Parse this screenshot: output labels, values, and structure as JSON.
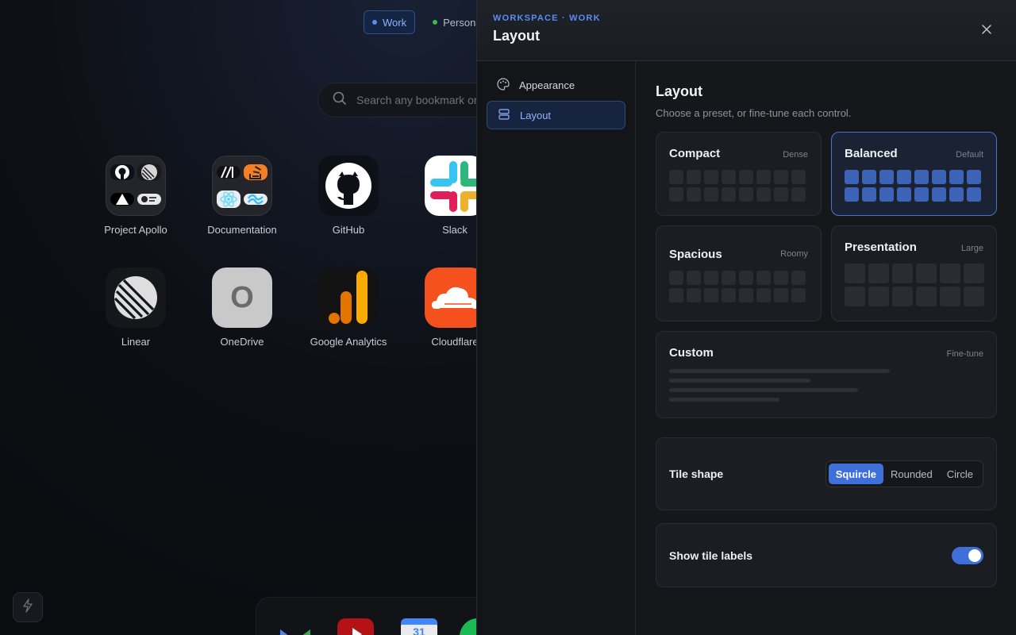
{
  "workspaces": [
    {
      "label": "Work",
      "color": "#5b8def",
      "active": true
    },
    {
      "label": "Personal",
      "color": "#3fb950",
      "active": false
    }
  ],
  "search": {
    "placeholder": "Search any bookmark or"
  },
  "tiles": [
    {
      "label": "Project Apollo",
      "icon": "folder-icon"
    },
    {
      "label": "Documentation",
      "icon": "folder-icon"
    },
    {
      "label": "GitHub",
      "icon": "github-icon"
    },
    {
      "label": "Slack",
      "icon": "slack-icon"
    },
    {
      "label": "Linear",
      "icon": "linear-icon"
    },
    {
      "label": "OneDrive",
      "icon": "onedrive-icon",
      "letter": "O"
    },
    {
      "label": "Google Analytics",
      "icon": "analytics-icon"
    },
    {
      "label": "Cloudflare",
      "icon": "cloudflare-icon"
    }
  ],
  "calendar_day": "31",
  "panel": {
    "eyebrow": "WORKSPACE · WORK",
    "title": "Layout",
    "nav": [
      {
        "label": "Appearance",
        "icon": "palette-icon"
      },
      {
        "label": "Layout",
        "icon": "layout-icon",
        "active": true
      }
    ],
    "section_title": "Layout",
    "section_subtitle": "Choose a preset, or fine-tune each control.",
    "presets": [
      {
        "name": "Compact",
        "tag": "Dense"
      },
      {
        "name": "Balanced",
        "tag": "Default",
        "selected": true
      },
      {
        "name": "Spacious",
        "tag": "Roomy"
      },
      {
        "name": "Presentation",
        "tag": "Large"
      },
      {
        "name": "Custom",
        "tag": "Fine-tune"
      }
    ],
    "tile_shape": {
      "label": "Tile shape",
      "options": [
        "Squircle",
        "Rounded",
        "Circle"
      ],
      "selected": "Squircle"
    },
    "show_labels": {
      "label": "Show tile labels",
      "on": true
    }
  },
  "colors": {
    "accent": "#3f6fd8",
    "accent_text": "#8fb2ff"
  }
}
